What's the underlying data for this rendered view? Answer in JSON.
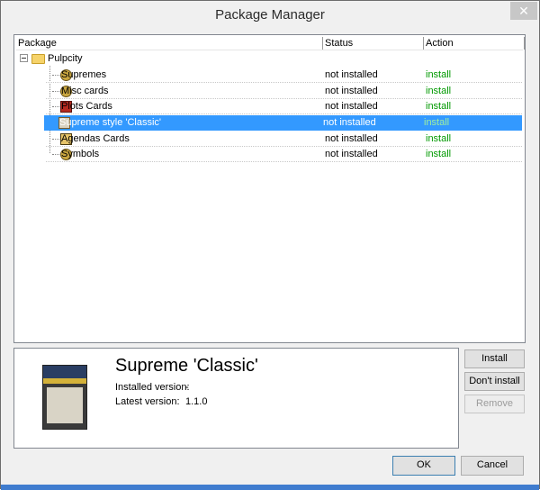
{
  "window": {
    "title": "Package Manager",
    "close_symbol": "✕"
  },
  "tree": {
    "columns": [
      "Package",
      "Status",
      "Action"
    ],
    "root": {
      "label": "Pulpcity"
    },
    "items": [
      {
        "label": "Supremes",
        "status": "not installed",
        "action": "install",
        "icon": "badge-icon",
        "selected": false
      },
      {
        "label": "Misc cards",
        "status": "not installed",
        "action": "install",
        "icon": "badge-icon",
        "selected": false
      },
      {
        "label": "Plots Cards",
        "status": "not installed",
        "action": "install",
        "icon": "plot-card-icon",
        "selected": false
      },
      {
        "label": "Supreme style 'Classic'",
        "status": "not installed",
        "action": "install",
        "icon": "card-style-icon",
        "selected": true
      },
      {
        "label": "Agendas Cards",
        "status": "not installed",
        "action": "install",
        "icon": "agenda-card-icon",
        "selected": false
      },
      {
        "label": "Symbols",
        "status": "not installed",
        "action": "install",
        "icon": "badge-icon",
        "selected": false
      }
    ],
    "selection_color": "#3399ff",
    "action_color": "#009900"
  },
  "details": {
    "title": "Supreme 'Classic'",
    "installed_label": "Installed version:",
    "installed_value": "-",
    "latest_label": "Latest version:",
    "latest_value": "1.1.0"
  },
  "buttons": {
    "install": "Install",
    "dont_install": "Don't install",
    "remove": "Remove",
    "ok": "OK",
    "cancel": "Cancel"
  }
}
